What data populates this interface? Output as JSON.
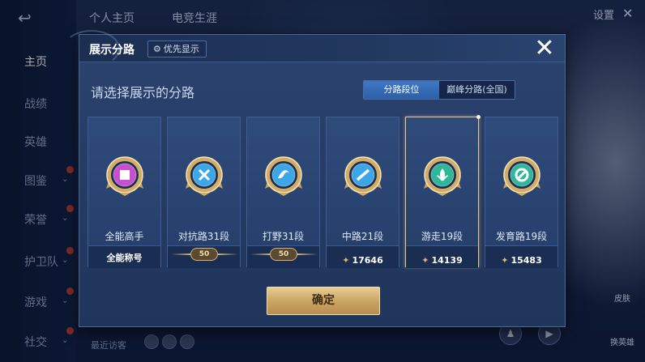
{
  "background": {
    "back_icon": "↩",
    "top_tabs": [
      "个人主页",
      "电竞生涯"
    ],
    "settings_label": "设置",
    "close_icon": "✕",
    "nav_items": [
      {
        "label": "主页",
        "active": true
      },
      {
        "label": "战绩"
      },
      {
        "label": "英雄"
      },
      {
        "label": "图鉴",
        "expandable": true
      },
      {
        "label": "荣誉",
        "expandable": true
      },
      {
        "label": "护卫队",
        "expandable": true
      },
      {
        "label": "游戏",
        "expandable": true
      },
      {
        "label": "社交",
        "expandable": true
      }
    ],
    "recent_label": "最近访客",
    "right_buttons": [
      "皮肤",
      "换英雄"
    ]
  },
  "modal": {
    "title": "展示分路",
    "priority_button": "优先显示",
    "priority_icon": "gear-icon",
    "close_icon": "✕",
    "subtitle": "请选择展示的分路",
    "segments": [
      {
        "label": "分路段位",
        "active": true
      },
      {
        "label": "巅峰分路(全国)",
        "active": false
      }
    ],
    "cards": [
      {
        "name": "全能高手",
        "footer_type": "label",
        "footer": "全能称号",
        "badge_color": "#c84fd0",
        "selected": false
      },
      {
        "name": "对抗路31段",
        "footer_type": "stars",
        "footer": "50",
        "badge_color": "#3ca7e8",
        "selected": false
      },
      {
        "name": "打野31段",
        "footer_type": "stars",
        "footer": "50",
        "badge_color": "#3ca7e8",
        "selected": false
      },
      {
        "name": "中路21段",
        "footer_type": "score",
        "footer": "17646",
        "badge_color": "#3ca7e8",
        "selected": false
      },
      {
        "name": "游走19段",
        "footer_type": "score",
        "footer": "14139",
        "badge_color": "#2fb79a",
        "selected": true
      },
      {
        "name": "发育路19段",
        "footer_type": "score",
        "footer": "15483",
        "badge_color": "#2fb79a",
        "selected": false
      }
    ],
    "confirm_label": "确定"
  }
}
